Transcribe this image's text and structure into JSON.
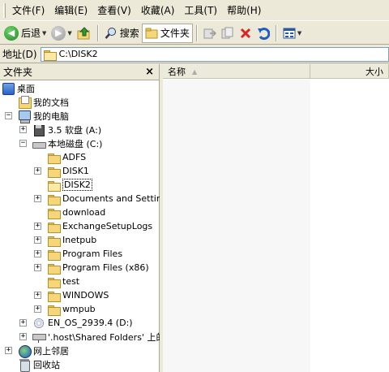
{
  "menu": {
    "items": [
      "文件(F)",
      "编辑(E)",
      "查看(V)",
      "收藏(A)",
      "工具(T)",
      "帮助(H)"
    ]
  },
  "toolbar": {
    "back_label": "后退",
    "search_label": "搜索",
    "folders_label": "文件夹"
  },
  "address": {
    "label": "地址(D)",
    "value": "C:\\DISK2"
  },
  "folder_pane": {
    "title": "文件夹",
    "close": "×"
  },
  "tree": {
    "desktop": "桌面",
    "my_documents": "我的文档",
    "my_computer": "我的电脑",
    "floppy": "3.5 软盘 (A:)",
    "local_disk": "本地磁盘 (C:)",
    "folders": [
      {
        "label": "ADFS",
        "expandable": false
      },
      {
        "label": "DISK1",
        "expandable": true
      },
      {
        "label": "DISK2",
        "expandable": false,
        "selected": true
      },
      {
        "label": "Documents and Settings",
        "expandable": true
      },
      {
        "label": "download",
        "expandable": false
      },
      {
        "label": "ExchangeSetupLogs",
        "expandable": true
      },
      {
        "label": "Inetpub",
        "expandable": true
      },
      {
        "label": "Program Files",
        "expandable": true
      },
      {
        "label": "Program Files (x86)",
        "expandable": true
      },
      {
        "label": "test",
        "expandable": false
      },
      {
        "label": "WINDOWS",
        "expandable": true
      },
      {
        "label": "wmpub",
        "expandable": true
      }
    ],
    "cd_drive": "EN_OS_2939.4 (D:)",
    "shared_drive": "'.host\\Shared Folders' 上的",
    "network": "网上邻居",
    "recycle_bin": "回收站"
  },
  "file_list": {
    "col_name": "名称",
    "col_size": "大小",
    "sort_arrow": "▲"
  },
  "colors": {
    "chrome": "#ece9d8",
    "address_border": "#7f9db9",
    "folder_yellow": "#f5d77a"
  }
}
